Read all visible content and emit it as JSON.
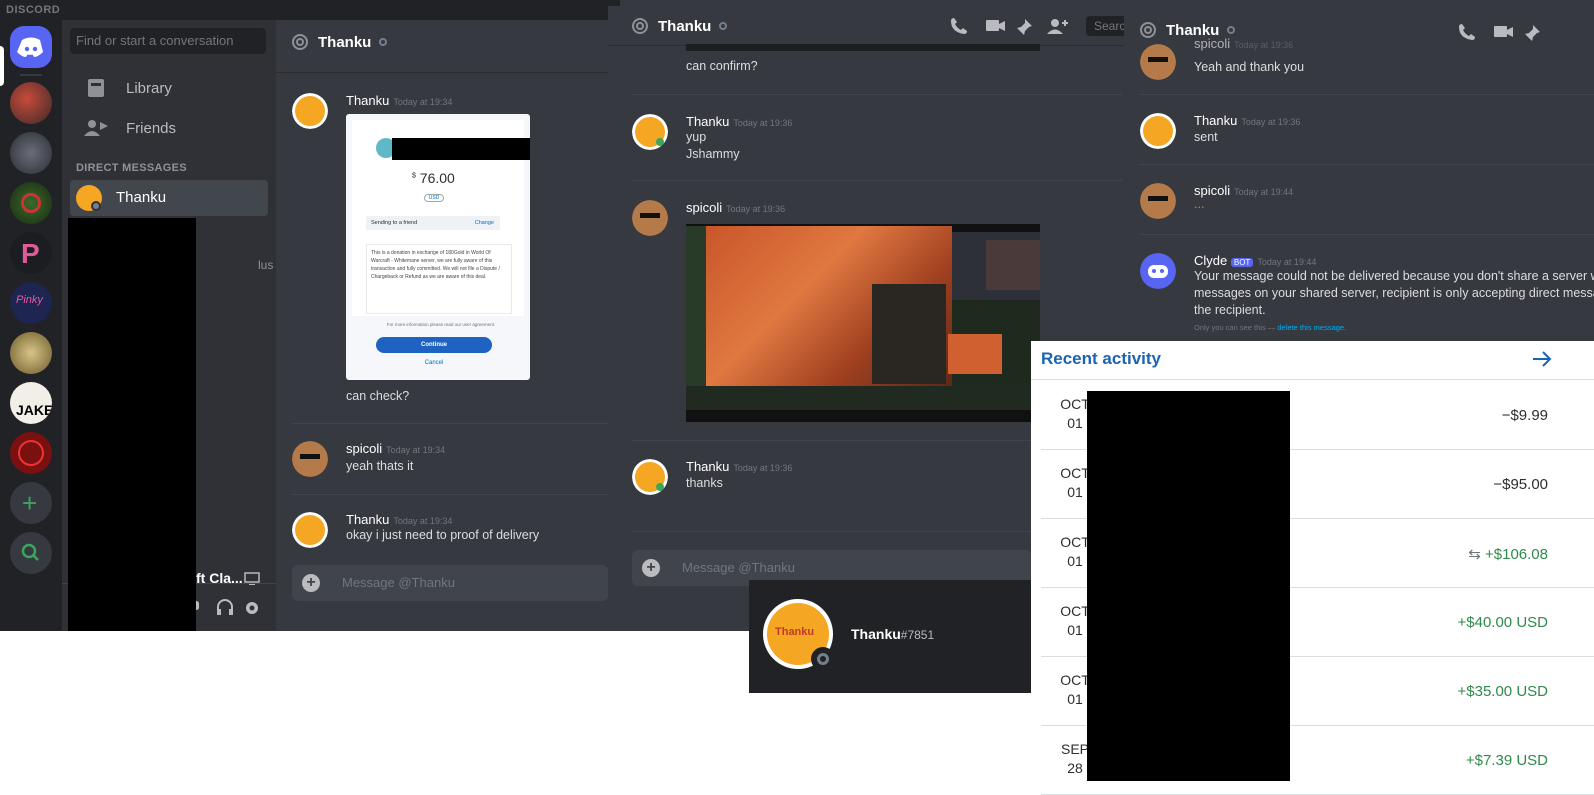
{
  "window1": {
    "brand": "DISCORD",
    "search_placeholder": "Find or start a conversation",
    "nav": [
      {
        "label": "Library"
      },
      {
        "label": "Friends"
      }
    ],
    "dm_header": "DIRECT MESSAGES",
    "dm_active_name": "Thanku",
    "nitro_fragment": "lus",
    "user_fragment": "ft Cla...",
    "channel_name": "Thanku",
    "messages": [
      {
        "author": "Thanku",
        "time": "Today at 19:34",
        "text": "can check?"
      },
      {
        "author": "spicoli",
        "time": "Today at 19:34",
        "text": "yeah thats it"
      },
      {
        "author": "Thanku",
        "time": "Today at 19:34",
        "text": "okay i just need to proof of delivery"
      }
    ],
    "composer_placeholder": "Message @Thanku",
    "paypal_card": {
      "amount": "76.00",
      "currency_symbol": "$",
      "currency_pill": "USD",
      "sending_label": "Sending to a friend",
      "change_label": "Change",
      "note": "This is a donation in exchange of 180Gold in World Of Warcraft - Whitemane server, we are fully aware of this transaction and fully committed. We will not file a Dispute / Chargeback or Refund as we are aware of this deal.",
      "more_info": "For more information please read our user agreement.",
      "continue_label": "Continue",
      "cancel_label": "Cancel"
    }
  },
  "window2": {
    "channel_name": "Thanku",
    "search_label": "Searc",
    "messages": [
      {
        "author": "",
        "time": "",
        "lines": [
          "can confirm?"
        ]
      },
      {
        "author": "Thanku",
        "time": "Today at 19:36",
        "lines": [
          "yup",
          "Jshammy"
        ]
      },
      {
        "author": "spicoli",
        "time": "Today at 19:36",
        "lines": []
      },
      {
        "author": "Thanku",
        "time": "Today at 19:36",
        "lines": [
          "thanks"
        ]
      }
    ],
    "composer_placeholder": "Message @Thanku",
    "profile": {
      "name": "Thanku",
      "tag": "#7851",
      "avatar_text": "Thanku"
    }
  },
  "window3": {
    "channel_name": "Thanku",
    "messages": [
      {
        "author": "spicoli",
        "time": "Today at 19:36",
        "lines": [
          "Yeah and thank you"
        ]
      },
      {
        "author": "Thanku",
        "time": "Today at 19:36",
        "lines": [
          "sent"
        ]
      },
      {
        "author": "spicoli",
        "time": "Today at 19:44",
        "lines": [
          "..."
        ]
      },
      {
        "author": "Clyde",
        "badge": "BOT",
        "time": "Today at 19:44",
        "lines": [
          "Your message could not be delivered because you don't share a server wi",
          "messages on your shared server, recipient is only accepting direct messag",
          "the recipient."
        ]
      }
    ],
    "only_you": "Only you can see this —",
    "delete_link": "delete this message."
  },
  "paypal": {
    "title": "Recent activity",
    "rows": [
      {
        "month": "OCT",
        "day": "01",
        "amount": "−$9.99",
        "kind": "debit"
      },
      {
        "month": "OCT",
        "day": "01",
        "amount": "−$95.00",
        "kind": "debit"
      },
      {
        "month": "OCT",
        "day": "01",
        "amount": "+$106.08",
        "kind": "transfer"
      },
      {
        "month": "OCT",
        "day": "01",
        "amount": "+$40.00 USD",
        "kind": "credit"
      },
      {
        "month": "OCT",
        "day": "01",
        "amount": "+$35.00 USD",
        "kind": "credit"
      },
      {
        "month": "SEP",
        "day": "28",
        "amount": "+$7.39 USD",
        "kind": "credit"
      }
    ]
  },
  "colors": {
    "discord_blurple": "#5865f2",
    "paypal_blue": "#1a64b4",
    "credit_green": "#2f8a4b"
  }
}
